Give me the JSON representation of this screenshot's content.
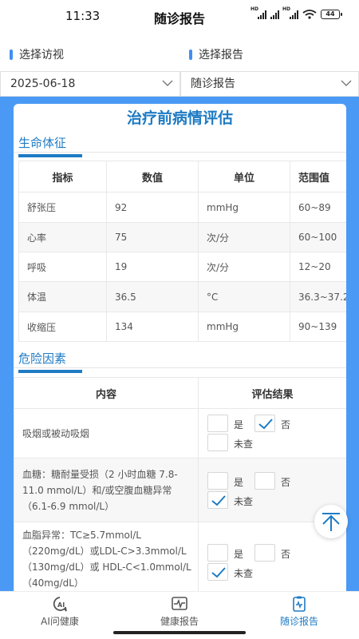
{
  "status": {
    "time": "11:33",
    "title": "随诊报告",
    "battery": "44"
  },
  "selectors": {
    "visit_label": "选择访视",
    "report_label": "选择报告",
    "visit_value": "2025-06-18",
    "report_value": "随诊报告"
  },
  "card": {
    "title": "治疗前病情评估"
  },
  "vitals": {
    "heading": "生命体征",
    "columns": [
      "指标",
      "数值",
      "单位",
      "范围值"
    ],
    "rows": [
      [
        "舒张压",
        "92",
        "mmHg",
        "60~89"
      ],
      [
        "心率",
        "75",
        "次/分",
        "60~100"
      ],
      [
        "呼吸",
        "19",
        "次/分",
        "12~20"
      ],
      [
        "体温",
        "36.5",
        "°C",
        "36.3~37.2"
      ],
      [
        "收缩压",
        "134",
        "mmHg",
        "90~139"
      ]
    ]
  },
  "risks": {
    "heading": "危险因素",
    "columns": [
      "内容",
      "评估结果"
    ],
    "options": {
      "yes": "是",
      "no": "否",
      "unchecked": "未查"
    },
    "rows": [
      {
        "content": "吸烟或被动吸烟",
        "checked": "no"
      },
      {
        "content": "血糖：糖耐量受损（2 小时血糖 7.8-11.0 mmol/L）和/或空腹血糖异常（6.1-6.9 mmol/L）",
        "checked": "unchecked"
      },
      {
        "content": "血脂异常：TC≥5.7mmol/L （220mg/dL）或LDL-C>3.3mmol/L（130mg/dL）或 HDL-C<1.0mmol/L（40mg/dL）",
        "checked": "unchecked"
      }
    ]
  },
  "tabs": [
    {
      "label": "AI问健康",
      "icon": "ai-chat-icon"
    },
    {
      "label": "健康报告",
      "icon": "heartbeat-monitor-icon"
    },
    {
      "label": "随诊报告",
      "icon": "clipboard-report-icon",
      "active": true
    }
  ],
  "colors": {
    "accent": "#1e7bc4",
    "background_blue": "#4a9af5"
  }
}
